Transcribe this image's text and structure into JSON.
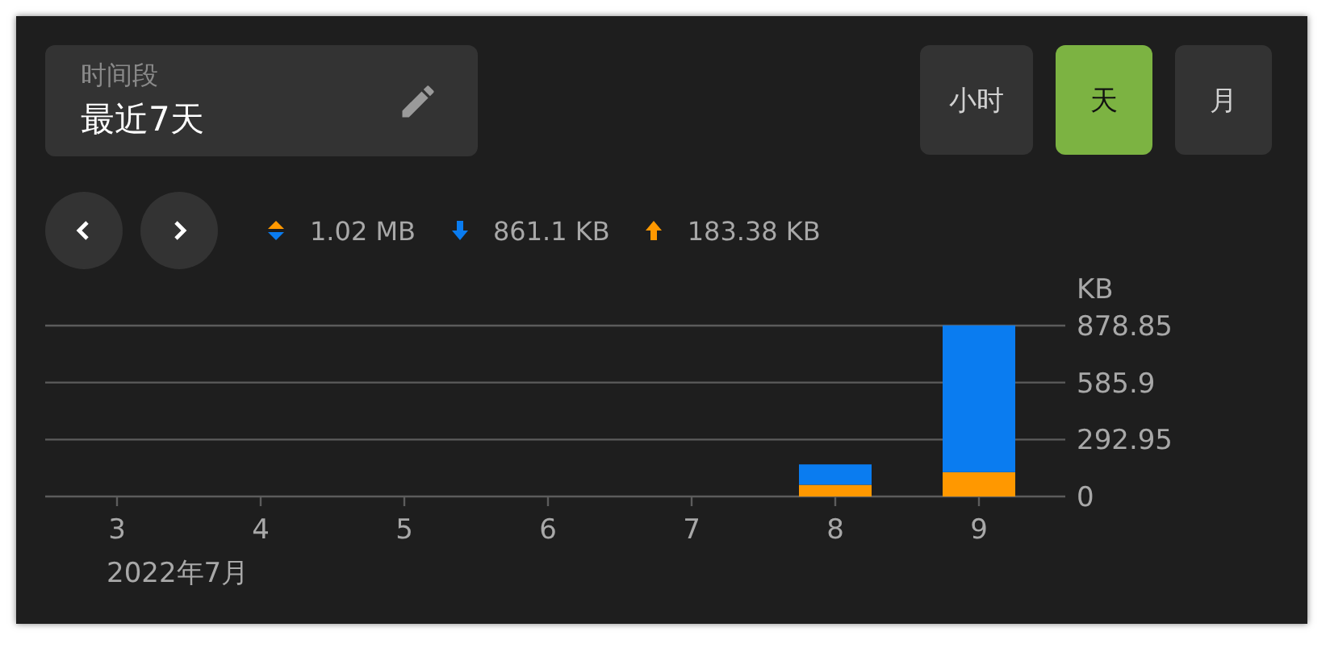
{
  "period_field": {
    "label": "时间段",
    "value": "最近7天"
  },
  "granularity_buttons": [
    {
      "label": "小时",
      "selected": false
    },
    {
      "label": "天",
      "selected": true
    },
    {
      "label": "月",
      "selected": false
    }
  ],
  "legend": [
    {
      "kind": "total",
      "value": "1.02 MB"
    },
    {
      "kind": "download",
      "value": "861.1 KB",
      "color": "#0a7cf0"
    },
    {
      "kind": "upload",
      "value": "183.38 KB",
      "color": "#ff9800"
    }
  ],
  "chart": {
    "chart_data": {
      "type": "bar",
      "stacked": true,
      "xlabel": "2022年7月",
      "ylabel": "KB",
      "categories": [
        "3",
        "4",
        "5",
        "6",
        "7",
        "8",
        "9"
      ],
      "series": [
        {
          "color": "#ff9800",
          "values": [
            0,
            0,
            0,
            0,
            0,
            60,
            125
          ]
        },
        {
          "color": "#0a7cf0",
          "values": [
            0,
            0,
            0,
            0,
            0,
            105,
            755
          ]
        }
      ],
      "ylim": [
        0,
        878.85
      ],
      "yticks": [
        0,
        292.95,
        585.9,
        878.85
      ]
    }
  }
}
